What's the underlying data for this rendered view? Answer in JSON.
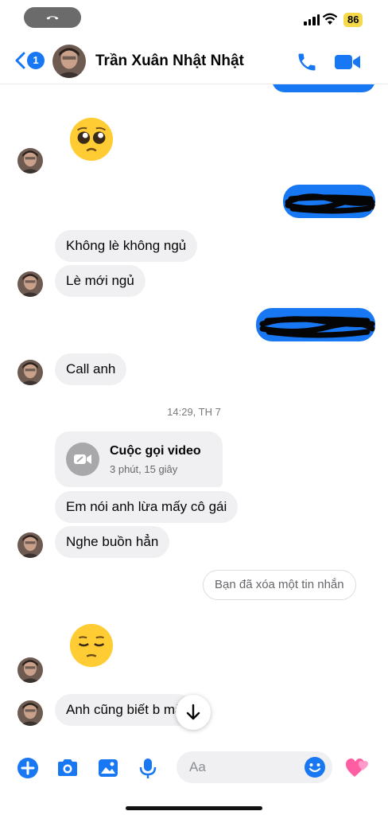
{
  "status_bar": {
    "battery": "86"
  },
  "header": {
    "back_count": "1",
    "contact_name": "Trần Xuân Nhật Nhật"
  },
  "messages": {
    "received_1": "Không lè không ngủ",
    "received_2": "Lè mới ngủ",
    "received_3": "Call anh",
    "timestamp": "14:29, TH 7",
    "call_title": "Cuộc gọi video",
    "call_duration": "3 phút, 15 giây",
    "received_4": "Em nói anh lừa mấy cô gái",
    "received_5": "Nghe buồn hẳn",
    "deleted_notice": "Bạn đã xóa một tin nhắn",
    "received_6": "Anh cũng biết b   mà"
  },
  "composer": {
    "placeholder": "Aa"
  },
  "colors": {
    "accent": "#1877f2",
    "bubble_received": "#f0f0f2",
    "battery": "#f5d94a"
  },
  "icons": [
    "phone-end-icon",
    "signal-icon",
    "wifi-icon",
    "back-chevron-icon",
    "phone-icon",
    "video-camera-icon",
    "pleading-face-emoji",
    "pensive-face-emoji",
    "video-call-missed-icon",
    "arrow-down-icon",
    "plus-icon",
    "camera-icon",
    "image-icon",
    "microphone-icon",
    "smiley-icon",
    "heart-icon"
  ]
}
